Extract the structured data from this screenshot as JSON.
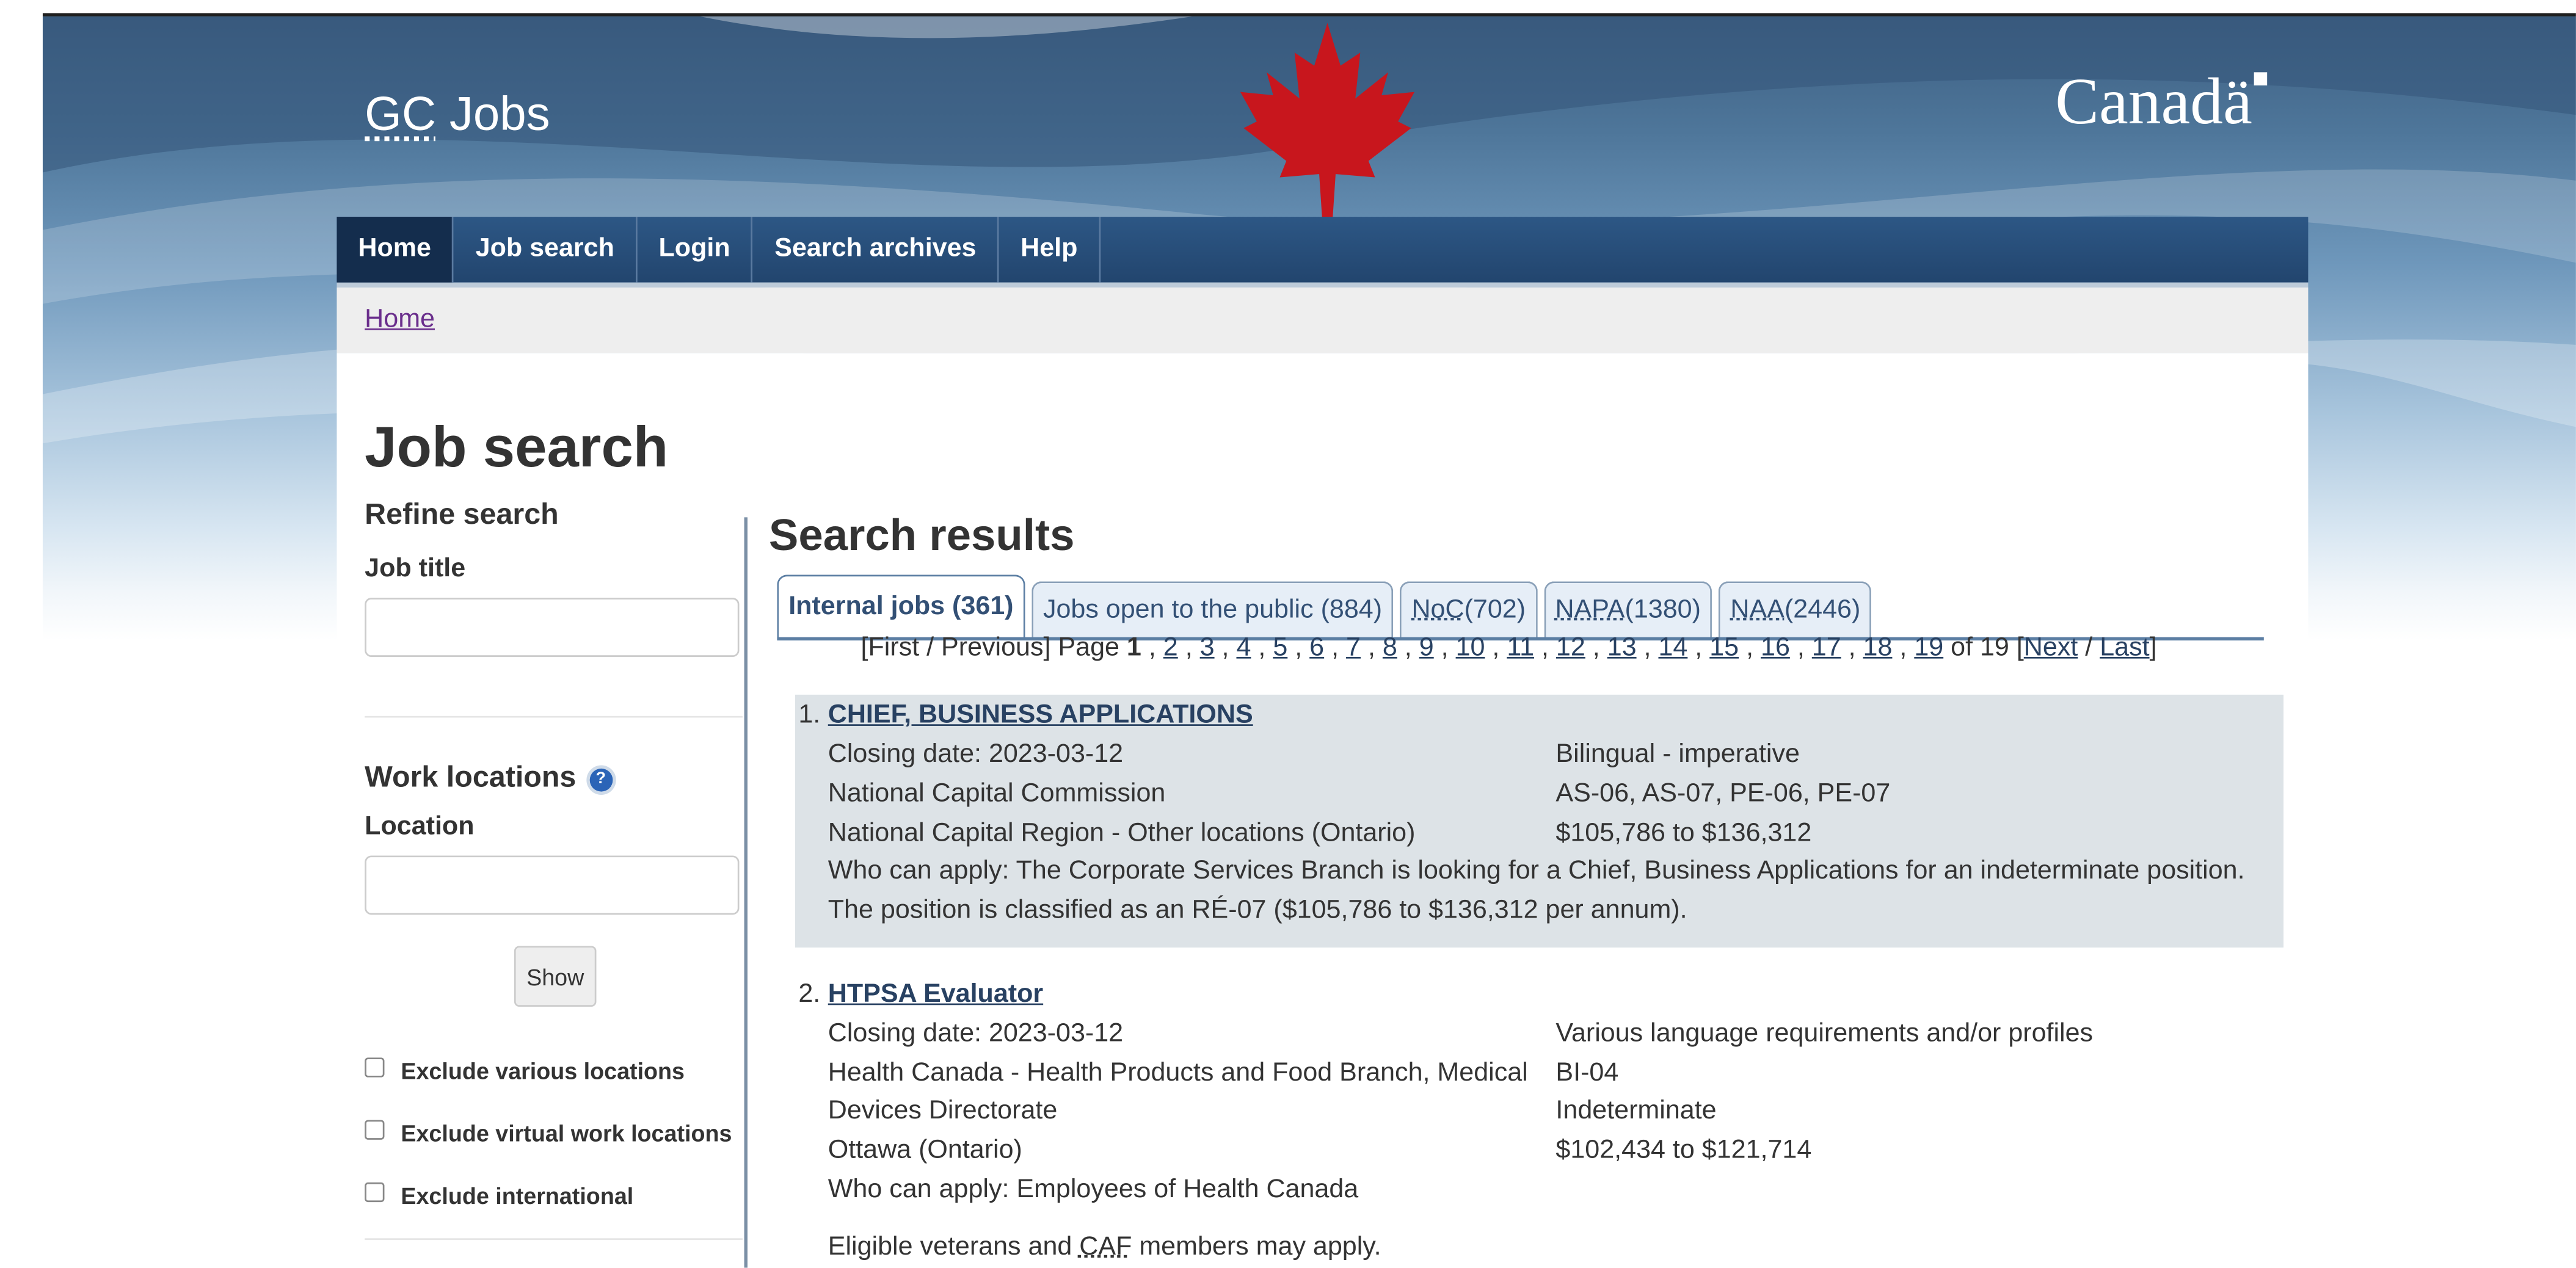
{
  "site": {
    "brand_abbr": "GC",
    "brand_rest": " Jobs",
    "wordmark": "Canad",
    "wordmark_last": "ä"
  },
  "menu": [
    "Home",
    "Job search",
    "Login",
    "Search archives",
    "Help"
  ],
  "breadcrumb": "Home",
  "page_title": "Job search",
  "sidebar": {
    "refine_heading": "Refine search",
    "job_title_label": "Job title",
    "job_title_value": "",
    "work_locations_heading": "Work locations",
    "help_icon_glyph": "?",
    "location_label": "Location",
    "location_value": "",
    "show_button": "Show",
    "checkboxes": [
      "Exclude various locations",
      "Exclude virtual work locations",
      "Exclude international"
    ]
  },
  "results": {
    "heading": "Search results",
    "tabs": [
      {
        "label": "Internal jobs (361)"
      },
      {
        "label": "Jobs open to the public (884)"
      },
      {
        "abbr": "NoC",
        "count": " (702)"
      },
      {
        "abbr": "NAPA",
        "count": " (1380)"
      },
      {
        "abbr": "NAA",
        "count": " (2446)"
      }
    ],
    "pager": {
      "prefix": "[First / Previous] Page ",
      "current": "1",
      "pages": [
        "2",
        "3",
        "4",
        "5",
        "6",
        "7",
        "8",
        "9",
        "10",
        "11",
        "12",
        "13",
        "14",
        "15",
        "16",
        "17",
        "18",
        "19"
      ],
      "of_text": " of 19 [",
      "next": "Next",
      "slash": " / ",
      "last": "Last",
      "suffix": "]"
    },
    "items": [
      {
        "num": "1.",
        "title": "CHIEF, BUSINESS APPLICATIONS",
        "left": [
          "Closing date: 2023-03-12",
          "National Capital Commission",
          "National Capital Region - Other locations (Ontario)"
        ],
        "right": [
          "Bilingual - imperative",
          "AS-06, AS-07, PE-06, PE-07",
          "$105,786 to $136,312"
        ],
        "full": [
          "Who can apply: The Corporate Services Branch is looking for a Chief, Business Applications for an indeterminate position.",
          "The position is classified as an RÉ-07 ($105,786 to $136,312 per annum)."
        ]
      },
      {
        "num": "2.",
        "title": "HTPSA Evaluator",
        "left": [
          "Closing date: 2023-03-12",
          "Health Canada - Health Products and Food Branch, Medical",
          "Devices Directorate",
          "Ottawa (Ontario)",
          "Who can apply: Employees of Health Canada"
        ],
        "right": [
          "Various language requirements and/or profiles",
          "BI-04",
          "Indeterminate",
          "$102,434 to $121,714"
        ],
        "note_pre": "Eligible veterans and ",
        "note_abbr": "CAF",
        "note_post": " members may apply."
      }
    ]
  }
}
